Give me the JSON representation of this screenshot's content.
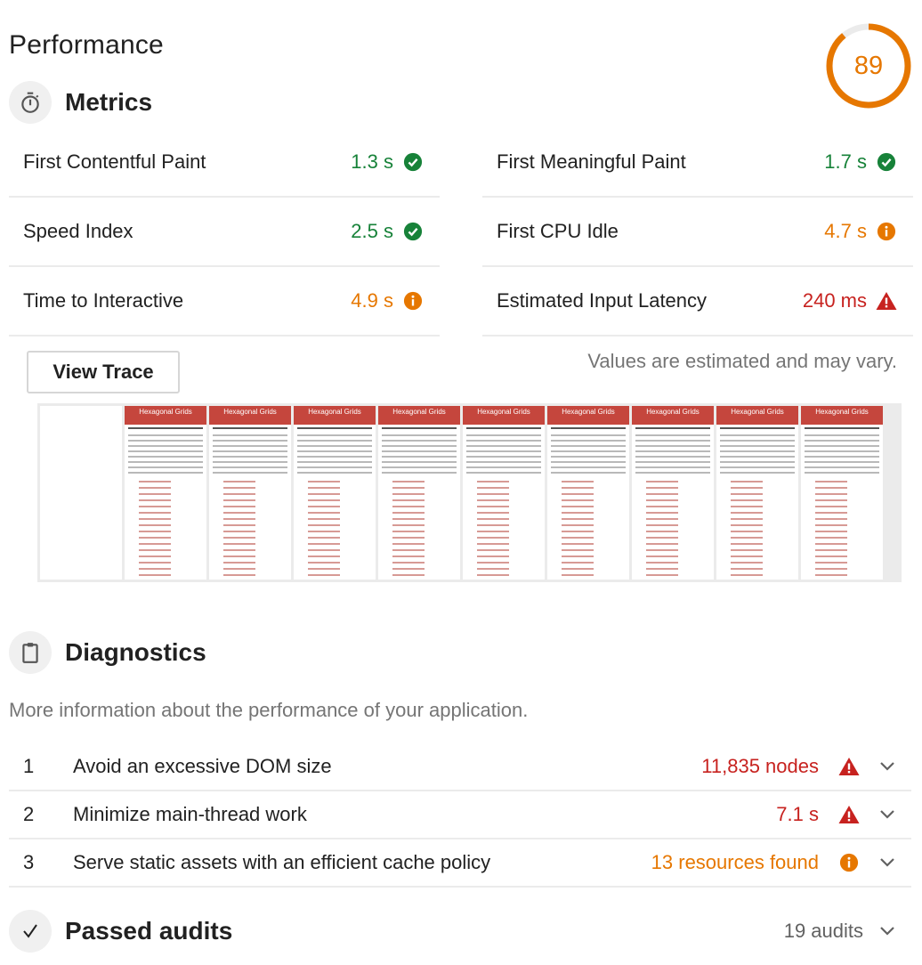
{
  "category": {
    "title": "Performance",
    "score": 89,
    "score_color": "#e67700"
  },
  "metrics": {
    "title": "Metrics",
    "icon": "stopwatch-icon",
    "left": [
      {
        "label": "First Contentful Paint",
        "value": "1.3 s",
        "status": "pass"
      },
      {
        "label": "Speed Index",
        "value": "2.5 s",
        "status": "pass"
      },
      {
        "label": "Time to Interactive",
        "value": "4.9 s",
        "status": "average"
      }
    ],
    "right": [
      {
        "label": "First Meaningful Paint",
        "value": "1.7 s",
        "status": "pass"
      },
      {
        "label": "First CPU Idle",
        "value": "4.7 s",
        "status": "average"
      },
      {
        "label": "Estimated Input Latency",
        "value": "240 ms",
        "status": "fail"
      }
    ],
    "view_trace_label": "View Trace",
    "disclaimer": "Values are estimated and may vary."
  },
  "filmstrip": {
    "frame_count": 10,
    "page_title": "Hexagonal Grids"
  },
  "diagnostics": {
    "title": "Diagnostics",
    "icon": "clipboard-icon",
    "description": "More information about the performance of your application.",
    "items": [
      {
        "index": "1",
        "title": "Avoid an excessive DOM size",
        "value": "11,835 nodes",
        "status": "fail"
      },
      {
        "index": "2",
        "title": "Minimize main-thread work",
        "value": "7.1 s",
        "status": "fail"
      },
      {
        "index": "3",
        "title": "Serve static assets with an efficient cache policy",
        "value": "13 resources found",
        "status": "average"
      }
    ]
  },
  "passed_audits": {
    "title": "Passed audits",
    "count": "19 audits",
    "icon": "checkmark-icon"
  },
  "colors": {
    "pass": "#178239",
    "average": "#e67700",
    "fail": "#c7221f"
  }
}
